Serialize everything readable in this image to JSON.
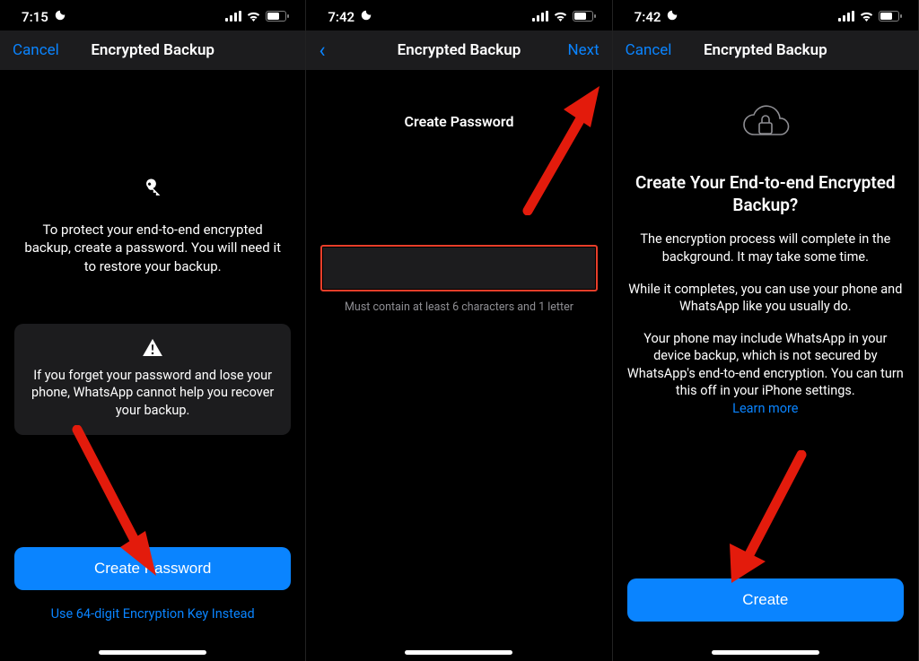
{
  "panel1": {
    "status_time": "7:15",
    "nav_left": "Cancel",
    "nav_title": "Encrypted Backup",
    "description": "To protect your end-to-end encrypted backup, create a password. You will need it to restore your backup.",
    "warning": "If you forget your password and lose your phone, WhatsApp cannot help you recover your backup.",
    "primary_btn": "Create Password",
    "secondary_link": "Use 64-digit Encryption Key Instead"
  },
  "panel2": {
    "status_time": "7:42",
    "nav_title": "Encrypted Backup",
    "nav_right": "Next",
    "heading": "Create Password",
    "hint": "Must contain at least 6 characters and 1 letter"
  },
  "panel3": {
    "status_time": "7:42",
    "nav_left": "Cancel",
    "nav_title": "Encrypted Backup",
    "heading": "Create Your End-to-end Encrypted Backup?",
    "para1": "The encryption process will complete in the background. It may take some time.",
    "para2": "While it completes, you can use your phone and WhatsApp like you usually do.",
    "para3": "Your phone may include WhatsApp in your device backup, which is not secured by WhatsApp's end-to-end encryption. You can turn this off in your iPhone settings.",
    "learn_more": "Learn more",
    "primary_btn": "Create"
  }
}
